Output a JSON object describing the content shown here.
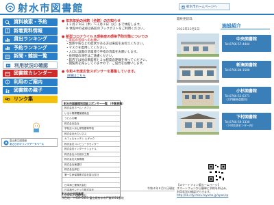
{
  "header": {
    "title": "射水市図書館",
    "home_link": "射水市ホームページへ"
  },
  "sidebar": {
    "items": [
      {
        "label": "資料検索・予約",
        "color": "blue"
      },
      {
        "label": "新着資料情報",
        "color": "blue"
      },
      {
        "label": "貸出ランキング",
        "color": "blue"
      },
      {
        "label": "予約ランキング",
        "color": "blue"
      },
      {
        "label": "新聞・雑誌一覧",
        "color": "blue"
      },
      {
        "label": "利用状況の確認",
        "color": "grey"
      },
      {
        "label": "図書館カレンダー",
        "color": "red"
      },
      {
        "label": "利用のご案内",
        "color": "blue"
      },
      {
        "label": "図書館の親子",
        "color": "blue"
      },
      {
        "label": "リンク集",
        "color": "yellow"
      }
    ],
    "banner_line1": "富山県立図書館",
    "banner_line2": "あさひかけリンクデータベース"
  },
  "notices": {
    "n1_head": "● 年末年始の休館（全館）のお知らせ",
    "n1_l1": "１２月２９日（木）～１月３日（火）まで休館します。",
    "n1_l2": "※ 休館中の返却は各館のブックポストをご利用ください。",
    "n2_head": "● 新型コロナウイルス感染症の感染予防対策についての",
    "n2_sub": "ご来館の皆様へのお願い",
    "n2_lines": [
      "・発熱や咳などの症状がある方は来館をお控えください。",
      "・マスクを着用してください。",
      "・入口に設置の消毒液で手指の消毒をお願いします。",
      "・長時間の滞在はご遠慮ください。",
      "・館内では他の来館者と２ｍ程度の距離を保ってください。",
      "・閲覧席を減らしていますので、ご協力をお願いします。"
    ],
    "n3_head": "● 令和４年度広告スポンサーを募集しています。",
    "n3_link": "詳細はこちら"
  },
  "sponsors": {
    "title": "射水市図書館利用証スポンサー一覧 （※敬称略）",
    "rows": [
      "株式会社ホーム・カフェ",
      "いるか警察署保護用品",
      "うどん大輔",
      "株式会社会社",
      "学校法人京山学院高等学校",
      "株式会社大力ジネス",
      "カフェ＆キッチン ルギャク",
      "株式会社コンピュータセンター",
      "株式会社インターナショナル",
      "株式会社小杉設計工業",
      "株式会社大阪精器",
      "株式会社東建材",
      "株式会社岸田",
      "第一生命保険株式会社富山支社",
      "",
      "日本海工業株式会社",
      "日本海サンテック株式会社",
      "日本海ガス株式会社",
      "株式会社北陸銀行",
      "株式会社日本",
      ""
    ],
    "date_note": "令和４年８月１日現在"
  },
  "footer": {
    "org": "射水市中央図書館",
    "addr": "所在地：〒939-0351 富山県射水市戸破3511番地",
    "tel": "電話：0766-56-1010 FAX：0766-56-1011"
  },
  "right": {
    "updated_label": "最終更新日：",
    "updated_date": "2022年12月1日",
    "facility_tab": "施設紹介",
    "branches": [
      {
        "name": "中央図書館",
        "tel": "Tel.0766-57-4444",
        "sub": ""
      },
      {
        "name": "新湊図書館",
        "tel": "Tel.0766-84-1500",
        "sub": ""
      },
      {
        "name": "小杉図書館",
        "tel": "Tel.0766-52-6271",
        "sub": "（大門総合会館内）"
      },
      {
        "name": "下村図書館",
        "tel": "Tel.0766-59-3330",
        "sub": "（下村交流センター内）"
      }
    ]
  },
  "smartphone": {
    "heading": "【スマートフォン版ホームページ】",
    "line1": "スマートフォンから簡単に予約を申込み、",
    "line2": "利用状況の確認ができます。",
    "url": "http://lib.city.imizu.toyama.jp/opac/sp"
  },
  "colors": {
    "accent_blue": "#2a7fc9",
    "accent_red": "#cf2a2a",
    "accent_yellow": "#f1c10b",
    "branch_blue": "#3a7fb8"
  }
}
